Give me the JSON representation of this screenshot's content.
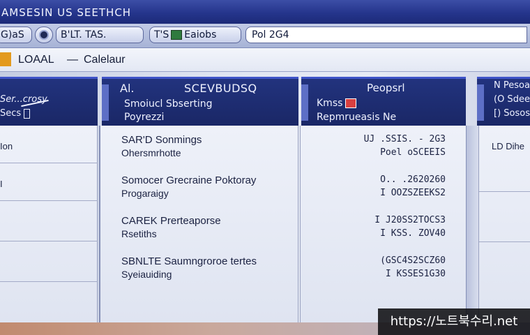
{
  "window": {
    "title": "AMSESIN US SEETHCH"
  },
  "toolbar": {
    "back_label": "G)aS",
    "tab1_label": "B'LT. TAS.",
    "tab2_prefix": "T'S",
    "tab2_label": "Eaiobs",
    "address_value": "Pol 2G4"
  },
  "path": {
    "root": "LOAAL",
    "separator": "—",
    "current": "Calelaur"
  },
  "left_panel": {
    "header_line1": "Ser...crosy",
    "header_line2": "Secs",
    "rows": [
      "Ion",
      "I",
      "",
      "",
      ""
    ]
  },
  "middle_panel": {
    "header_a": "Al.",
    "header_b": "SCEVBUDSQ",
    "header_line1": "Smoiucl Sbserting",
    "header_line2": "Poyrezzi",
    "rows": [
      {
        "line1": "SAR'D Sonmings",
        "line2": "Ohersmrhotte"
      },
      {
        "line1": "Somocer Grecraine Poktoray",
        "line2": "Progaraigy"
      },
      {
        "line1": "CAREK Prerteaporse",
        "line2": "Rsetiths"
      },
      {
        "line1": "SBNLTE Saumngroroe tertes",
        "line2": "Syeiauiding"
      }
    ]
  },
  "number_panel": {
    "header_top": "Peopsrl",
    "header_line1": "Kmss",
    "header_line2": "Repmrueasis Ne",
    "rows": [
      {
        "line1": "UJ  .SSIS. - 2G3",
        "line2": "Poel oSCEEIS"
      },
      {
        "line1": "O..  .2620260",
        "line2": "I OOZSZEEKS2"
      },
      {
        "line1": "I  J20SS2TOCS3",
        "line2": "I KSS. ZOV40"
      },
      {
        "line1": "(GSC4S2SCZ60",
        "line2": "I KSSES1G30"
      }
    ]
  },
  "right_panel": {
    "header_line1": "N Pesoaz",
    "header_line2": "(O Sdee",
    "header_line3": "[) Sosos",
    "body_text": "LD Dihe"
  },
  "watermark": {
    "text": "https://노트북수리.net"
  },
  "colors": {
    "title_bar": "#25358c",
    "header_band": "#1f2e78",
    "accent_blue": "#3f54c8",
    "path_chip": "#e39a1e",
    "flag_red": "#d94040",
    "flag_green": "#2f7a3e"
  }
}
